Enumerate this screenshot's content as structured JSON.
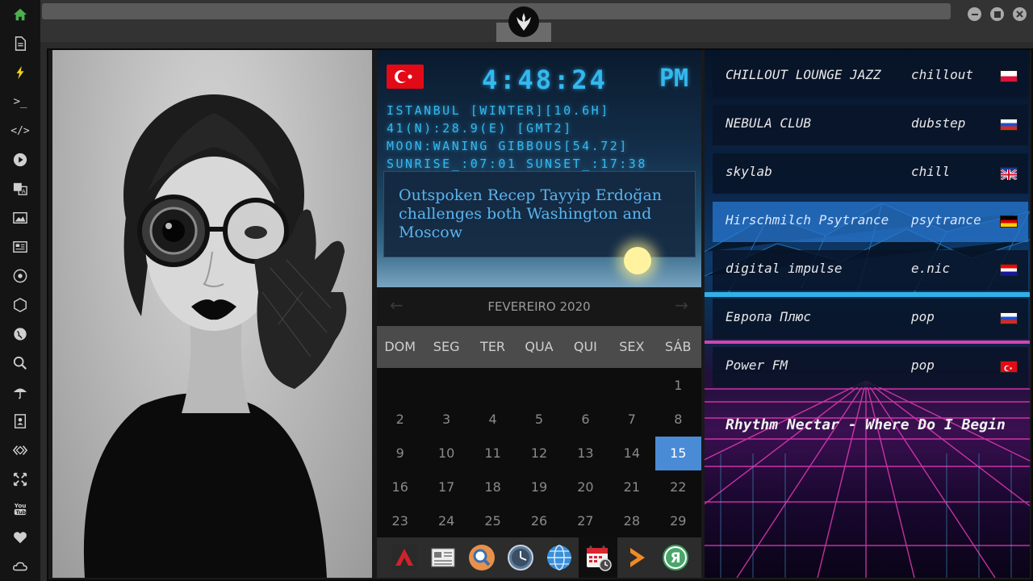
{
  "sidebar": {
    "items": [
      {
        "name": "home-icon",
        "glyph": "⌂"
      },
      {
        "name": "document-icon",
        "glyph": "🗎"
      },
      {
        "name": "lightning-icon",
        "glyph": "⚡"
      },
      {
        "name": "terminal-icon",
        "glyph": ">_"
      },
      {
        "name": "code-icon",
        "glyph": "</>"
      },
      {
        "name": "play-icon",
        "glyph": "▶"
      },
      {
        "name": "translate-icon",
        "glyph": "文A"
      },
      {
        "name": "image-icon",
        "glyph": "▨"
      },
      {
        "name": "news-icon",
        "glyph": "▤"
      },
      {
        "name": "aperture-icon",
        "glyph": "✲"
      },
      {
        "name": "hexagon-icon",
        "glyph": "⬡"
      },
      {
        "name": "globe-icon",
        "glyph": "◍"
      },
      {
        "name": "search-icon",
        "glyph": "⚲"
      },
      {
        "name": "umbrella-icon",
        "glyph": "☂"
      },
      {
        "name": "contacts-icon",
        "glyph": "▣"
      },
      {
        "name": "embed-icon",
        "glyph": "◇"
      },
      {
        "name": "fullscreen-icon",
        "glyph": "✥"
      },
      {
        "name": "youtube-icon",
        "glyph": "You"
      },
      {
        "name": "heart-icon",
        "glyph": "♥"
      },
      {
        "name": "cloud-icon",
        "glyph": "☁"
      }
    ]
  },
  "clock": {
    "time": "4:48:24",
    "ampm": "PM",
    "line1": "ISTANBUL [WINTER][10.6H]",
    "line2": "41(N):28.9(E) [GMT2]",
    "line3": "MOON:WANING GIBBOUS[54.72]",
    "line4": "SUNRISE_:07:01 SUNSET_:17:38",
    "news": "Outspoken Recep Tayyip Erdoğan challenges both Washington and Moscow"
  },
  "calendar": {
    "month": "FEVEREIRO 2020",
    "prev": "←",
    "next": "→",
    "weekdays": [
      "DOM",
      "SEG",
      "TER",
      "QUA",
      "QUI",
      "SEX",
      "SÁB"
    ],
    "today": "15",
    "days": [
      "1",
      "2",
      "3",
      "4",
      "5",
      "6",
      "7",
      "8",
      "9",
      "10",
      "11",
      "12",
      "13",
      "14",
      "15",
      "16",
      "17",
      "18",
      "19",
      "20",
      "21",
      "22",
      "23",
      "24",
      "25",
      "26",
      "27",
      "28",
      "29"
    ]
  },
  "dock": {
    "items": [
      {
        "name": "red-arrow-app-icon"
      },
      {
        "name": "news-app-icon"
      },
      {
        "name": "search-app-icon"
      },
      {
        "name": "clock-app-icon"
      },
      {
        "name": "globe-app-icon"
      },
      {
        "name": "calendar-app-icon"
      },
      {
        "name": "forward-app-icon"
      },
      {
        "name": "yandex-app-icon",
        "glyph": "Я"
      }
    ]
  },
  "radio": {
    "stations": [
      {
        "name": "CHILLOUT LOUNGE JAZZ",
        "genre": "chillout",
        "flag": "poland"
      },
      {
        "name": "NEBULA CLUB",
        "genre": "dubstep",
        "flag": "russia"
      },
      {
        "name": "skylab",
        "genre": "chill",
        "flag": "uk"
      },
      {
        "name": "Hirschmilch Psytrance",
        "genre": "psytrance",
        "flag": "germany"
      },
      {
        "name": "digital impulse",
        "genre": "e.nic",
        "flag": "croatia"
      },
      {
        "name": "Европа Плюс",
        "genre": "pop",
        "flag": "russia"
      },
      {
        "name": "Power FM",
        "genre": "pop",
        "flag": "turkey"
      }
    ],
    "selected_index": 3,
    "now_playing": "Rhythm Nectar - Where Do I Begin"
  },
  "colors": {
    "accent": "#4a8bd6",
    "lcd": "#34b8f0",
    "home_active": "#4caf50"
  }
}
